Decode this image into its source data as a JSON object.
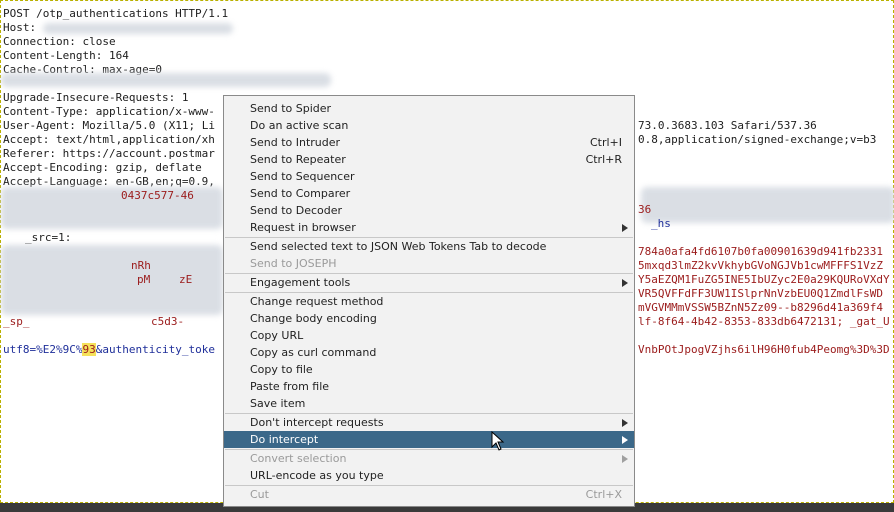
{
  "request": {
    "request_line": "POST /otp_authentications HTTP/1.1",
    "headers": [
      {
        "name": "Host:",
        "value": ""
      },
      {
        "name": "Connection:",
        "value": "close"
      },
      {
        "name": "Content-Length:",
        "value": "164"
      },
      {
        "name": "Cache-Control:",
        "value": "max-age=0"
      },
      {
        "name": "",
        "value": ""
      },
      {
        "name": "Upgrade-Insecure-Requests:",
        "value": "1"
      },
      {
        "name": "Content-Type:",
        "value": "application/x-www-"
      },
      {
        "name": "User-Agent:",
        "value": "Mozilla/5.0 (X11; Li"
      },
      {
        "name": "Accept:",
        "value": "text/html,application/xh"
      },
      {
        "name": "Referer:",
        "value": "https://account.postmar"
      },
      {
        "name": "Accept-Encoding:",
        "value": "gzip, deflate"
      },
      {
        "name": "Accept-Language:",
        "value": "en-GB,en;q=0.9,"
      }
    ],
    "right_fragments": {
      "user_agent_tail": "73.0.3683.103 Safari/537.36",
      "accept_tail": "0.8,application/signed-exchange;v=b3",
      "cookie_frag_1": "36",
      "cookie_frag_2": "_hs",
      "cookie_frag_3": "784a0afa4fd6107b0fa00901639d941fb2331",
      "cookie_frag_4": "5mxqd3lmZ2kvVkhybGVoNGJVb1cwMFFFS1VzZ",
      "cookie_frag_5": "Y5aEZQM1FuZG5INE5IbUZyc2E0a29KQURoVXdY",
      "cookie_frag_6": "VR5QVFFdFF3UW1ISlprNnVzbEU0Q1ZmdlFsWD",
      "cookie_frag_7": "mVGVMMmVSSW5BZnN5Zz09--b8296d41a369f4",
      "cookie_frag_8": "lf-8f64-4b42-8353-833db6472131; _gat_U",
      "body_tail": "VnbPOtJpogVZjhs6ilH96H0fub4Peomg%3D%3D"
    },
    "left_fragments": {
      "src": "_src=1:",
      "frag_a": "0437c577-46",
      "frag_b": "nRh",
      "frag_c": "pM",
      "frag_d": "zE",
      "frag_e": "c5d3-",
      "sp": "_sp_"
    },
    "body_prefix": "utf8=%E2%9C%",
    "body_highlight": "93",
    "body_after": "&authenticity_toke"
  },
  "menu": {
    "items": [
      {
        "label": "Send to Spider"
      },
      {
        "label": "Do an active scan"
      },
      {
        "label": "Send to Intruder",
        "shortcut": "Ctrl+I"
      },
      {
        "label": "Send to Repeater",
        "shortcut": "Ctrl+R"
      },
      {
        "label": "Send to Sequencer"
      },
      {
        "label": "Send to Comparer"
      },
      {
        "label": "Send to Decoder"
      },
      {
        "label": "Request in browser",
        "submenu": true
      },
      {
        "label": "Send selected text to JSON Web Tokens Tab to decode"
      },
      {
        "label": "Send to JOSEPH",
        "disabled": true
      },
      {
        "label": "Engagement tools",
        "submenu": true
      },
      {
        "label": "Change request method"
      },
      {
        "label": "Change body encoding"
      },
      {
        "label": "Copy URL"
      },
      {
        "label": "Copy as curl command"
      },
      {
        "label": "Copy to file"
      },
      {
        "label": "Paste from file"
      },
      {
        "label": "Save item"
      },
      {
        "label": "Don't intercept requests",
        "submenu": true
      },
      {
        "label": "Do intercept",
        "submenu": true,
        "selected": true
      },
      {
        "label": "Convert selection",
        "submenu": true,
        "disabled": true
      },
      {
        "label": "URL-encode as you type"
      },
      {
        "label": "Cut",
        "shortcut": "Ctrl+X",
        "disabled": true
      }
    ]
  },
  "colors": {
    "menu_selected_bg": "#3b6889",
    "param_name": "#1f2f9a",
    "param_value": "#9b1b1b",
    "highlight": "#f5e25a"
  }
}
